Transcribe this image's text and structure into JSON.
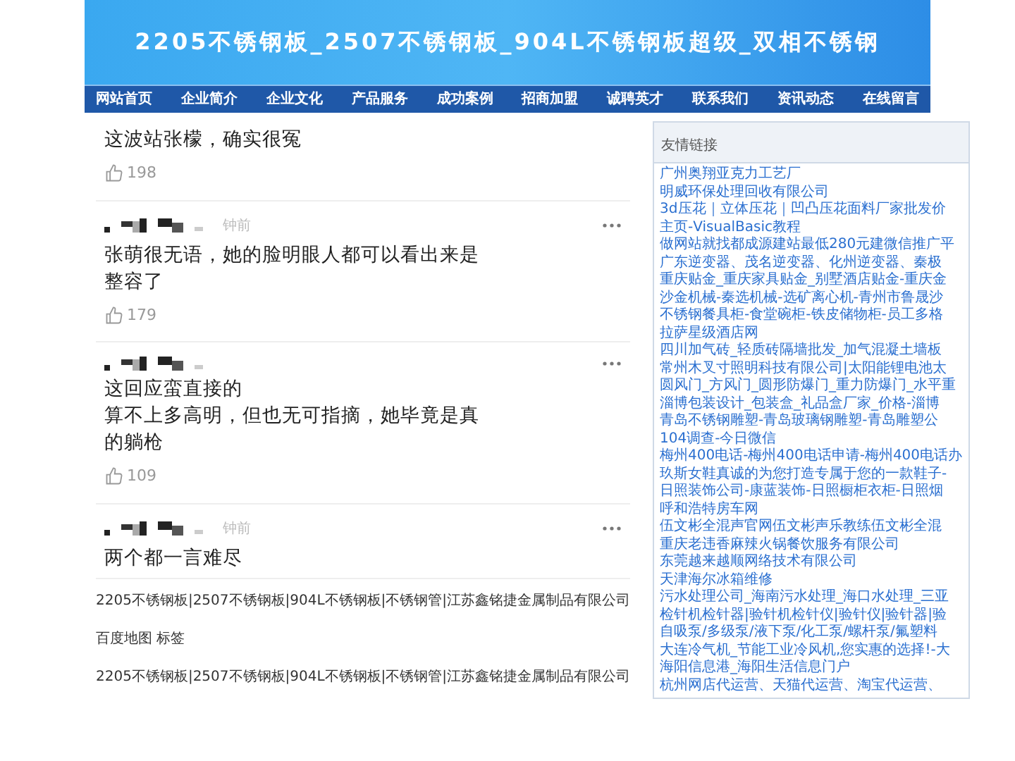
{
  "header": {
    "title": "2205不锈钢板_2507不锈钢板_904L不锈钢板超级_双相不锈钢"
  },
  "nav": [
    "网站首页",
    "企业简介",
    "企业文化",
    "产品服务",
    "成功案例",
    "招商加盟",
    "诚聘英才",
    "联系我们",
    "资讯动态",
    "在线留言"
  ],
  "comments": [
    {
      "show_header": false,
      "lines": [
        "这波站张檬，确实很冤"
      ],
      "likes": "198"
    },
    {
      "show_header": true,
      "time": "钟前",
      "lines": [
        "张萌很无语，她的脸明眼人都可以看出来是",
        "整容了"
      ],
      "likes": "179"
    },
    {
      "show_header": true,
      "lines": [
        "这回应蛮直接的",
        "算不上多高明，但也无可指摘，她毕竟是真",
        "的躺枪"
      ],
      "likes": "109"
    },
    {
      "show_header": true,
      "time": "钟前",
      "lines": [
        "两个都一言难尽"
      ]
    }
  ],
  "footer": [
    "2205不锈钢板|2507不锈钢板|904L不锈钢板|不锈钢管|江苏鑫铭捷金属制品有限公司",
    "百度地图 标签",
    "2205不锈钢板|2507不锈钢板|904L不锈钢板|不锈钢管|江苏鑫铭捷金属制品有限公司"
  ],
  "sidebar": {
    "title": "友情链接",
    "links": [
      "广州奥翔亚克力工艺厂",
      "明威环保处理回收有限公司",
      "3d压花｜立体压花｜凹凸压花面料厂家批发价",
      "主页-VisualBasic教程",
      "做网站就找都成源建站最低280元建微信推广平",
      "广东逆变器、茂名逆变器、化州逆变器、秦极",
      "重庆贴金_重庆家具贴金_别墅酒店贴金-重庆金",
      "沙金机械-秦选机械-选矿离心机-青州市鲁晟沙",
      "不锈钢餐具柜-食堂碗柜-铁皮储物柜-员工多格",
      "拉萨星级酒店网",
      "四川加气砖_轻质砖隔墙批发_加气混凝土墙板",
      "常州木叉寸照明科技有限公司|太阳能锂电池太",
      "圆风门_方风门_圆形防爆门_重力防爆门_水平重",
      "淄博包装设计_包装盒_礼品盒厂家_价格-淄博",
      "青岛不锈钢雕塑-青岛玻璃钢雕塑-青岛雕塑公",
      "104调查-今日微信",
      "梅州400电话-梅州400电话申请-梅州400电话办",
      "玖斯女鞋真诚的为您打造专属于您的一款鞋子-",
      "日照装饰公司-康蓝装饰-日照橱柜衣柜-日照烟",
      "呼和浩特房车网",
      "伍文彬全混声官网伍文彬声乐教练伍文彬全混",
      "重庆老违香麻辣火锅餐饮服务有限公司",
      "东莞越来越顺网络技术有限公司",
      "天津海尔冰箱维修",
      "污水处理公司_海南污水处理_海口水处理_三亚",
      "检针机检针器|验针机检针仪|验针仪|验针器|验",
      "自吸泵/多级泵/液下泵/化工泵/螺杆泵/氟塑料",
      "大连冷气机_节能工业冷风机,您实惠的选择!-大",
      "海阳信息港_海阳生活信息门户",
      "杭州网店代运营、天猫代运营、淘宝代运营、"
    ]
  }
}
